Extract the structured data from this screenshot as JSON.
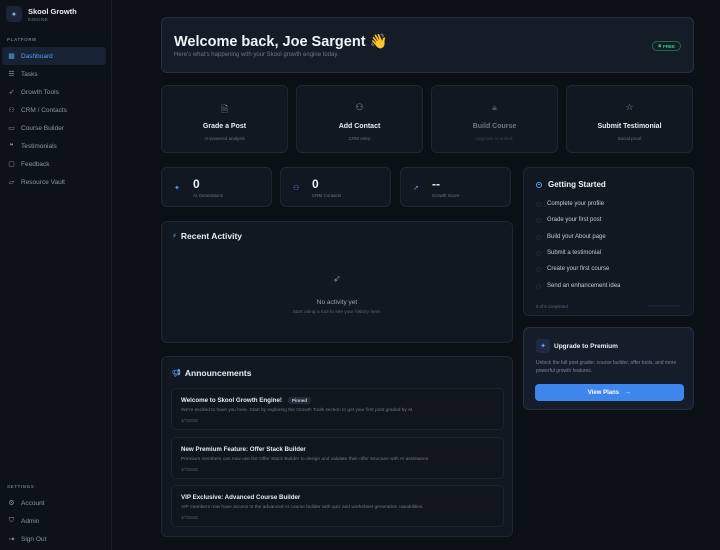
{
  "brand": {
    "name": "Skool Growth",
    "sub": "ENGINE",
    "icon": "sparkle-icon"
  },
  "sidebar": {
    "platform_label": "PLATFORM",
    "items": [
      {
        "label": "Dashboard",
        "icon": "grid-icon",
        "active": true
      },
      {
        "label": "Tasks",
        "icon": "list-icon"
      },
      {
        "label": "Growth Tools",
        "icon": "rocket-icon"
      },
      {
        "label": "CRM / Contacts",
        "icon": "users-icon"
      },
      {
        "label": "Course Builder",
        "icon": "book-icon"
      },
      {
        "label": "Testimonials",
        "icon": "quote-icon"
      },
      {
        "label": "Feedback",
        "icon": "message-icon"
      },
      {
        "label": "Resource Vault",
        "icon": "folder-icon"
      }
    ],
    "settings_label": "SETTINGS",
    "settings_items": [
      {
        "label": "Account",
        "icon": "gear-icon"
      },
      {
        "label": "Admin",
        "icon": "shield-icon"
      },
      {
        "label": "Sign Out",
        "icon": "logout-icon"
      }
    ]
  },
  "welcome": {
    "title": "Welcome back, Joe Sargent 👋",
    "subtitle": "Here's what's happening with your Skool growth engine today.",
    "badge": "FREE"
  },
  "actions": [
    {
      "title": "Grade a Post",
      "sub": "AI-powered analysis",
      "icon": "document-icon"
    },
    {
      "title": "Add Contact",
      "sub": "CRM entry",
      "icon": "users-icon"
    },
    {
      "title": "Build Course",
      "sub": "Upgrade to unlock",
      "icon": "lock-icon",
      "disabled": true
    },
    {
      "title": "Submit Testimonial",
      "sub": "Social proof",
      "icon": "star-icon"
    }
  ],
  "stats": [
    {
      "value": "0",
      "label": "AI Generations",
      "icon": "sparkle-icon"
    },
    {
      "value": "0",
      "label": "CRM Contacts",
      "icon": "users-icon"
    },
    {
      "value": "--",
      "label": "Growth Score",
      "icon": "trend-icon"
    }
  ],
  "activity": {
    "title": "Recent Activity",
    "empty_title": "No activity yet",
    "empty_sub": "Start using a tool to see your history here."
  },
  "announcements": {
    "title": "Announcements",
    "items": [
      {
        "title": "Welcome to Skool Growth Engine!",
        "pinned": "Pinned",
        "body": "We're excited to have you here. Start by exploring the Growth Tools section to get your first post graded by AI.",
        "date": "4/7/2026"
      },
      {
        "title": "New Premium Feature: Offer Stack Builder",
        "body": "Premium members can now use the Offer Stack Builder to design and validate their offer structure with AI assistance.",
        "date": "4/7/2026"
      },
      {
        "title": "VIP Exclusive: Advanced Course Builder",
        "body": "VIP members now have access to the advanced AI course builder with quiz and worksheet generation capabilities.",
        "date": "4/7/2026"
      }
    ]
  },
  "getting_started": {
    "title": "Getting Started",
    "items": [
      "Complete your profile",
      "Grade your first post",
      "Build your About page",
      "Submit a testimonial",
      "Create your first course",
      "Send an enhancement idea"
    ],
    "progress_text": "0 of 6 completed",
    "progress": 0
  },
  "upgrade": {
    "title": "Upgrade to Premium",
    "text": "Unlock the full post grader, course builder, offer tools, and more powerful growth features.",
    "button": "View Plans"
  },
  "colors": {
    "accent": "#3f86ec",
    "background": "#0b0f16",
    "free_badge": "#3ec787"
  }
}
